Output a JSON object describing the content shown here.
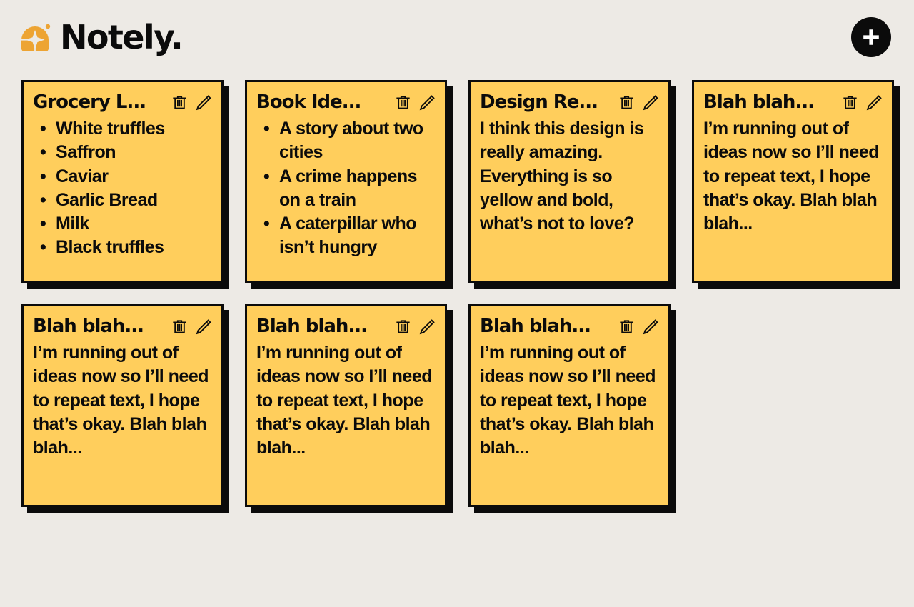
{
  "app": {
    "brand_name": "Notely.",
    "logo_icon": "sparkle-arch-logo",
    "logo_color": "#EDA433",
    "background_color": "#EDEAE5",
    "accent_color": "#FFCE5C",
    "ink_color": "#0B0B0B"
  },
  "header": {
    "add_button": {
      "icon": "plus-icon",
      "label": "Add note",
      "background": "#0B0B0B",
      "glyph_color": "#FFFFFF"
    }
  },
  "note_actions": {
    "delete_icon": "trash-icon",
    "delete_label": "Delete note",
    "edit_icon": "pencil-icon",
    "edit_label": "Edit note"
  },
  "notes": [
    {
      "title": "Grocery L...",
      "type": "list",
      "items": [
        "White truffles",
        "Saffron",
        "Caviar",
        "Garlic Bread",
        "Milk",
        "Black truffles"
      ]
    },
    {
      "title": "Book Ide...",
      "type": "list",
      "items": [
        "A story about two cities",
        "A crime happens on a train",
        "A caterpillar who isn’t hungry"
      ]
    },
    {
      "title": "Design Re...",
      "type": "text",
      "body": "I think this design is really amazing. Everything is so yellow and bold, what’s not to love?"
    },
    {
      "title": "Blah blah...",
      "type": "text",
      "body": "I’m running out of ideas now so I’ll need to repeat text, I hope that’s okay. Blah blah blah..."
    },
    {
      "title": "Blah blah...",
      "type": "text",
      "body": "I’m running out of ideas now so I’ll need to repeat text, I hope that’s okay. Blah blah blah..."
    },
    {
      "title": "Blah blah...",
      "type": "text",
      "body": "I’m running out of ideas now so I’ll need to repeat text, I hope that’s okay. Blah blah blah..."
    },
    {
      "title": "Blah blah...",
      "type": "text",
      "body": "I’m running out of ideas now so I’ll need to repeat text, I hope that’s okay. Blah blah blah..."
    }
  ]
}
